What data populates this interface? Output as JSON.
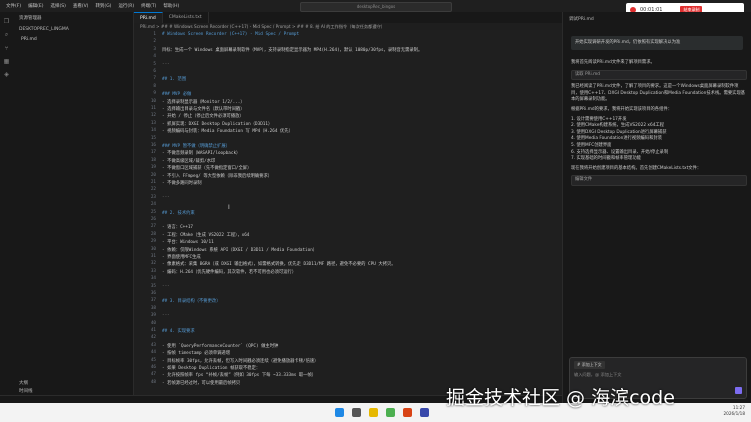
{
  "titlebar": {
    "menu": [
      "文件(F)",
      "编辑(E)",
      "选择(S)",
      "查看(V)",
      "转到(G)",
      "运行(R)",
      "终端(T)",
      "帮助(H)"
    ],
    "search_placeholder": "desktopRec_bingos"
  },
  "recorder": {
    "time": "00:01:01",
    "stop_label": "结束录制"
  },
  "sidebar": {
    "header": "资源管理器",
    "folder": "DESKTOPREC_LINGMA",
    "file": "PRi.md",
    "outline": "大纲",
    "timeline": "时间线"
  },
  "tabs": [
    {
      "label": "PRi.md",
      "active": true
    },
    {
      "label": "CMakeLists.txt",
      "active": false
    }
  ],
  "breadcrumb": "PRi.md > ## # Windows Screen Recorder (C++17) - Mid Spec / Prompt > ## # 8. 给 AI 的工作指令（每次任务都遵守）",
  "editor": {
    "lines": [
      {
        "n": "1",
        "t": "# Windows Screen Recorder (C++17) - Mid Spec / Prompt",
        "k": "h"
      },
      {
        "n": "2",
        "t": "",
        "k": "t"
      },
      {
        "n": "3",
        "t": "目标：生成一个 Windows 桌面屏幕录制软件（MVP），支持录制指定显示器为 MP4(H.264)，默认 1080p/30fps，录制音无需录制。",
        "k": "t"
      },
      {
        "n": "4",
        "t": "",
        "k": "t"
      },
      {
        "n": "5",
        "t": "---",
        "k": "d"
      },
      {
        "n": "6",
        "t": "",
        "k": "t"
      },
      {
        "n": "7",
        "t": "## 1. 范围",
        "k": "h"
      },
      {
        "n": "8",
        "t": "",
        "k": "t"
      },
      {
        "n": "9",
        "t": "### MVP 必做",
        "k": "h"
      },
      {
        "n": "10",
        "t": "- 选择录制显示器（Monitor 1/2/...）",
        "k": "t"
      },
      {
        "n": "11",
        "t": "- 选择输出目录与文件名（默认带时间戳）",
        "k": "t"
      },
      {
        "n": "12",
        "t": "- 开始 / 停止（停止后文件必须可播放）",
        "k": "t"
      },
      {
        "n": "13",
        "t": "- 抓屏实现：DXGI Desktop Duplication（D3D11）",
        "k": "t"
      },
      {
        "n": "14",
        "t": "- 视频编码与封装：Media Foundation 写 MP4（H.264 优先）",
        "k": "t"
      },
      {
        "n": "15",
        "t": "",
        "k": "t"
      },
      {
        "n": "16",
        "t": "### MVP 暂不做（明确禁止扩展）",
        "k": "h"
      },
      {
        "n": "17",
        "t": "- 不做音频录制（WASAPI/loopback）",
        "k": "t"
      },
      {
        "n": "18",
        "t": "- 不做高级区域/裁剪/水印",
        "k": "t"
      },
      {
        "n": "19",
        "t": "- 不做窗口区域捕获（先不做指定窗口/全屏）",
        "k": "t"
      },
      {
        "n": "20",
        "t": "- 不引入 FFmpeg/ 等大型依赖（除非我后续明确要求）",
        "k": "t"
      },
      {
        "n": "21",
        "t": "- 不做多路同时录制",
        "k": "t"
      },
      {
        "n": "22",
        "t": "",
        "k": "t"
      },
      {
        "n": "23",
        "t": "---",
        "k": "d"
      },
      {
        "n": "24",
        "t": "",
        "k": "t"
      },
      {
        "n": "25",
        "t": "## 2. 技术约束",
        "k": "h"
      },
      {
        "n": "26",
        "t": "",
        "k": "t"
      },
      {
        "n": "27",
        "t": "- 语言：C++17",
        "k": "t"
      },
      {
        "n": "28",
        "t": "- 工程：CMake（生成 VS2022 工程），x64",
        "k": "t"
      },
      {
        "n": "29",
        "t": "- 平台：Windows 10/11",
        "k": "t"
      },
      {
        "n": "30",
        "t": "- 依赖：仅限Windows 系统 API（DXGI / D3D11 / Media Foundation）",
        "k": "t"
      },
      {
        "n": "31",
        "t": "- 界面使用MFC生成",
        "k": "t"
      },
      {
        "n": "32",
        "t": "- 像素格式：采集 BGRA（或 DXGI 输出格式），如需格式转换，优先走 D3D11/MF 路径，避免不必要的 CPU 大拷贝。",
        "k": "t"
      },
      {
        "n": "33",
        "t": "- 编码：H.264（优先硬件编码，其次软件，若不可用也必须可运行）",
        "k": "t"
      },
      {
        "n": "34",
        "t": "",
        "k": "t"
      },
      {
        "n": "35",
        "t": "---",
        "k": "d"
      },
      {
        "n": "36",
        "t": "",
        "k": "t"
      },
      {
        "n": "37",
        "t": "## 3. 目录结构（不要更改）",
        "k": "h"
      },
      {
        "n": "38",
        "t": "",
        "k": "t"
      },
      {
        "n": "39",
        "t": "---",
        "k": "d"
      },
      {
        "n": "40",
        "t": "",
        "k": "t"
      },
      {
        "n": "41",
        "t": "## 4. 实现要求",
        "k": "h"
      },
      {
        "n": "42",
        "t": "",
        "k": "t"
      },
      {
        "n": "43",
        "t": "- 使用 `QueryPerformanceCounter` (QPC) 做主时钟",
        "k": "t"
      },
      {
        "n": "44",
        "t": "- 按帧 timestamp 必须单调递增",
        "k": "t"
      },
      {
        "n": "45",
        "t": "- 目标帧率 30fps，允许丢帧，但写入时间戳必须连续（避免播放器卡顿/倍速）",
        "k": "t"
      },
      {
        "n": "46",
        "t": "- 如果 Desktop Duplication 帧获取不稳定：",
        "k": "t"
      },
      {
        "n": "47",
        "t": "  - 允许按照帧率 fps “补帧/丢帧”（例如 30fps 下每 ~33.333ms 取一帧）",
        "k": "t"
      },
      {
        "n": "48",
        "t": "  - 若帧源已经过时，可以使用最后帧拷贝",
        "k": "t"
      }
    ]
  },
  "chat": {
    "header": "调试PRi.md",
    "user_message": "开始实现调研开发的PRi.md，仍依照有实现解决以为准",
    "paragraphs": [
      "我将首先阅读PRi.md文件来了解项目需求。",
      "我已经阅读了PRi.md文件，了解了项目的要求。这是一个Windows桌面屏幕录制软件项目，使用C++17、DXGI Desktop Duplication和Media Foundation技术栈。需要实现基本的屏幕录制功能。",
      "根据PRi.md的要求，我将开始实现该项目的各组件："
    ],
    "tool_label": "读取 PRi.md",
    "steps": [
      "1. 设计需要使用C++17开发",
      "2. 使用CMake构建系统，生成VS2022 x64工程",
      "3. 使用DXGI Desktop Duplication进行屏幕捕获",
      "4. 使用Media Foundation进行视频编码和封装",
      "5. 使用MFC创建界面",
      "6. 支持选择显示器、设置输出目录、开始/停止录制",
      "7. 实现基础的时间戳和帧率管理功能"
    ],
    "closing": "现在我将开始创建项目的基本结构。首先创建CMakeLists.txt文件：",
    "tool2_label": "编辑文件",
    "context_chip": "# 添加上下文",
    "input_placeholder": "输入问题，@ 添加上下文"
  },
  "taskbar": {
    "time": "11:27",
    "date": "2026/1/18"
  },
  "watermark": "掘金技术社区 @ 海滨code"
}
